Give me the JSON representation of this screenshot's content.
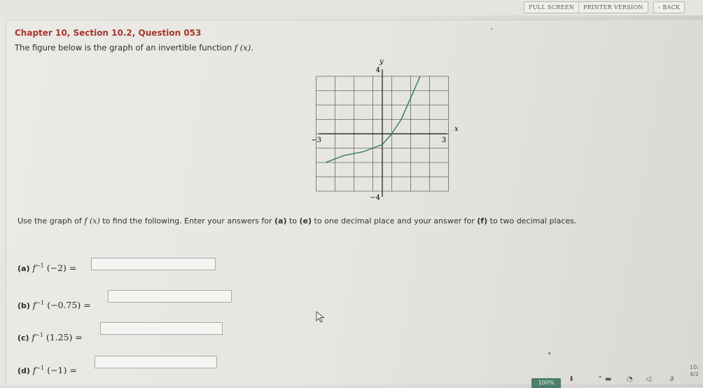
{
  "toolbar": {
    "full_screen": "FULL SCREEN",
    "printer_version": "PRINTER VERSION",
    "back": "BACK"
  },
  "question": {
    "title": "Chapter 10, Section 10.2, Question 053",
    "description_prefix": "The figure below is the graph of an invertible function ",
    "description_math": "f (x)",
    "description_suffix": "."
  },
  "graph": {
    "y_label": "y",
    "x_label": "x",
    "y_max_label": "4",
    "y_min_label": "−4",
    "x_min_label": "−3",
    "x_max_label": "3",
    "curve_color": "#2f7a5a"
  },
  "chart_data": {
    "type": "line",
    "series": [
      {
        "x": [
          -3,
          -2,
          -1,
          0,
          0.5,
          1,
          1.5,
          2
        ],
        "y": [
          -2,
          -1.5,
          -1.25,
          -0.75,
          0,
          1,
          2.5,
          4
        ]
      }
    ],
    "xlim": [
      -3,
      3
    ],
    "ylim": [
      -4,
      4
    ],
    "xlabel": "x",
    "ylabel": "y",
    "grid": true
  },
  "instructions": {
    "prefix": "Use the graph of ",
    "math": "f (x)",
    "middle1": " to find the following. Enter your answers for ",
    "a": "(a)",
    "to1": " to ",
    "e": "(e)",
    "middle2": " to one decimal place and your answer for ",
    "f": "(f)",
    "suffix": " to two decimal places."
  },
  "parts": [
    {
      "label": "(a)",
      "arg": "(−2)",
      "value": ""
    },
    {
      "label": "(b)",
      "arg": "(−0.75)",
      "value": ""
    },
    {
      "label": "(c)",
      "arg": "(1.25)",
      "value": ""
    },
    {
      "label": "(d)",
      "arg": "(−1)",
      "value": ""
    }
  ],
  "taskbar": {
    "zoom": "100%",
    "clock_line1": "10:",
    "clock_line2": "4/2"
  }
}
